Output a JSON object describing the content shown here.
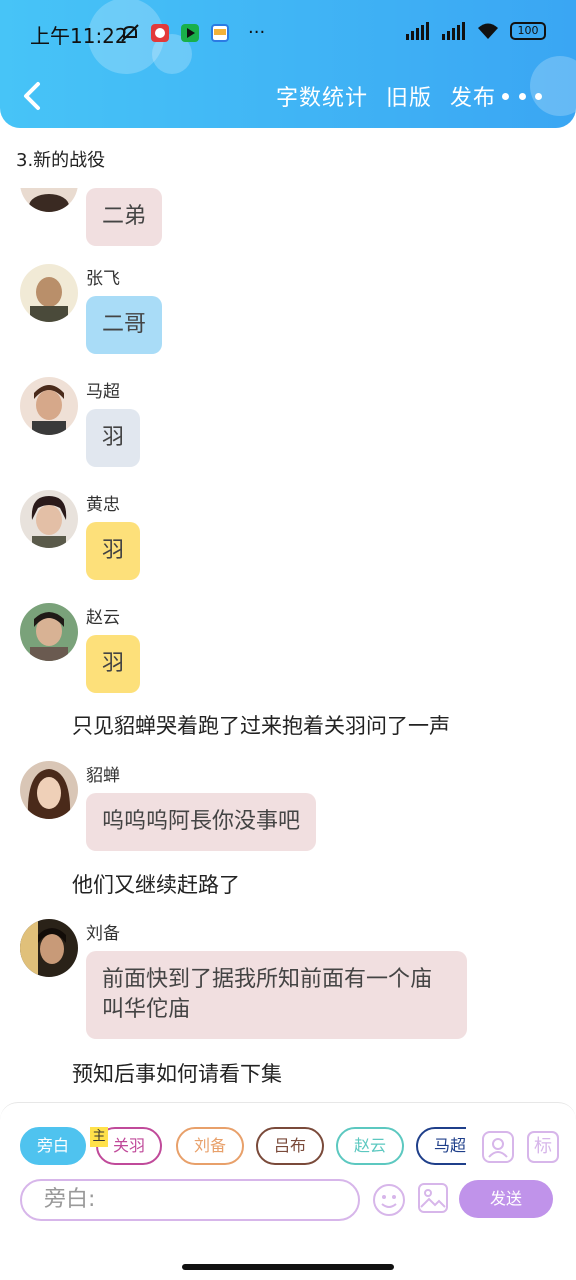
{
  "status_bar": {
    "time": "上午11:22",
    "battery": "100",
    "icons": [
      "mute-icon",
      "app-badge-icon",
      "video-app-icon",
      "notepad-icon",
      "more-dots-icon"
    ],
    "right_icons": [
      "hd-signal-icon",
      "signal-icon",
      "wifi-icon",
      "battery-icon"
    ],
    "overflow": "···"
  },
  "nav": {
    "back_icon": "chevron-left-icon",
    "word_count": "字数统计",
    "old_version": "旧版",
    "publish": "发布",
    "more_icon": "more-horizontal-icon"
  },
  "chapter_title": "3.新的战役",
  "messages": [
    {
      "type": "bubble",
      "name": "",
      "text": "二弟",
      "bubble_color": "#f1dfe0"
    },
    {
      "type": "bubble",
      "name": "张飞",
      "text": "二哥",
      "bubble_color": "#a9dcf7"
    },
    {
      "type": "bubble",
      "name": "马超",
      "text": "羽",
      "bubble_color": "#e1e7ef"
    },
    {
      "type": "bubble",
      "name": "黄忠",
      "text": "羽",
      "bubble_color": "#fde07a"
    },
    {
      "type": "bubble",
      "name": "赵云",
      "text": "羽",
      "bubble_color": "#fde07a"
    },
    {
      "type": "narration",
      "text": "只见貂蝉哭着跑了过来抱着关羽问了一声"
    },
    {
      "type": "bubble",
      "name": "貂蝉",
      "text": "呜呜呜阿長你没事吧",
      "bubble_color": "#f1dfe0"
    },
    {
      "type": "narration",
      "text": "他们又继续赶路了"
    },
    {
      "type": "bubble",
      "name": "刘备",
      "text_lines": [
        "前面快到了据我所知前面有一个庙",
        "叫华佗庙"
      ],
      "bubble_color": "#f1dfe0"
    },
    {
      "type": "narration",
      "text": "预知后事如何请看下集"
    }
  ],
  "composer": {
    "roles": [
      {
        "label": "旁白",
        "color": "#4fc3ef",
        "active": true
      },
      {
        "label": "关羽",
        "color": "#c04a9a"
      },
      {
        "label": "刘备",
        "color": "#e8a06a"
      },
      {
        "label": "吕布",
        "color": "#7a4a3a"
      },
      {
        "label": "赵云",
        "color": "#5cc8c0"
      },
      {
        "label": "马超",
        "color": "#1f3f8a"
      }
    ],
    "master_tag": "主",
    "add_role_icon": "add-person-icon",
    "tag_label": "标",
    "input_placeholder": "旁白:",
    "emoji_icon": "emoji-icon",
    "image_icon": "image-icon",
    "send_label": "发送"
  }
}
